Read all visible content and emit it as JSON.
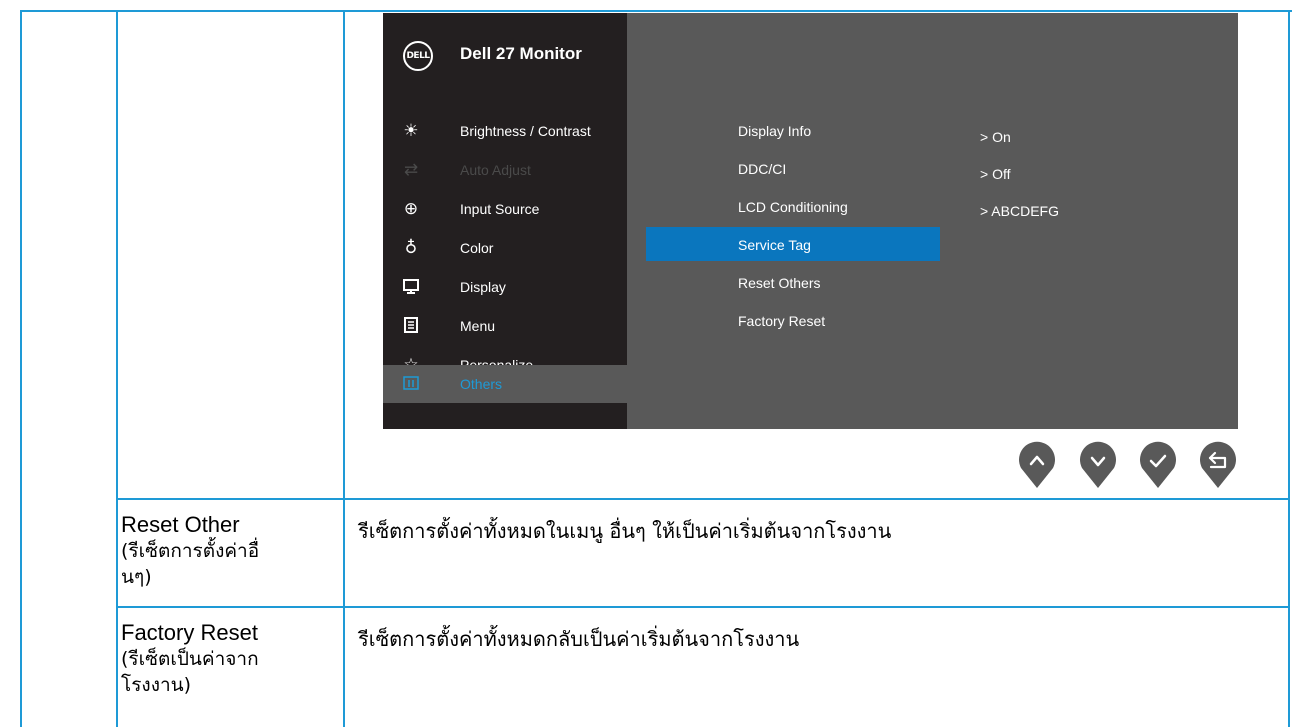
{
  "osd": {
    "title": "Dell 27 Monitor",
    "logo_text": "DELL",
    "menu": [
      {
        "label": "Brightness / Contrast",
        "icon": "brightness-icon",
        "state": "normal"
      },
      {
        "label": "Auto Adjust",
        "icon": "auto-adjust-icon",
        "state": "disabled"
      },
      {
        "label": "Input Source",
        "icon": "input-source-icon",
        "state": "normal"
      },
      {
        "label": "Color",
        "icon": "color-icon",
        "state": "normal"
      },
      {
        "label": "Display",
        "icon": "display-icon",
        "state": "normal"
      },
      {
        "label": "Menu",
        "icon": "menu-icon",
        "state": "normal"
      },
      {
        "label": "Personalize",
        "icon": "star-icon",
        "state": "normal"
      },
      {
        "label": "Others",
        "icon": "others-icon",
        "state": "active"
      }
    ],
    "submenu": [
      {
        "label": "Display Info"
      },
      {
        "label": "DDC/CI",
        "value": ">  On"
      },
      {
        "label": "LCD Conditioning",
        "value": ">  Off"
      },
      {
        "label": "Service Tag",
        "value": ">  ABCDEFG",
        "selected": true
      },
      {
        "label": "Reset Others"
      },
      {
        "label": "Factory Reset"
      }
    ],
    "nav_buttons": [
      "up-icon",
      "down-icon",
      "check-icon",
      "back-icon"
    ],
    "colors": {
      "accent": "#1e9ad6",
      "selected": "#0a76be",
      "panel": "#231f20",
      "background": "#595959"
    }
  },
  "rows": [
    {
      "name_en": "Reset Other",
      "name_th_1": "(รีเซ็ตการตั้งค่าอื่",
      "name_th_2": "นๆ)",
      "description": "รีเซ็ตการตั้งค่าทั้งหมดในเมนู อื่นๆ ให้เป็นค่าเริ่มต้นจากโรงงาน"
    },
    {
      "name_en": "Factory Reset",
      "name_th_1": "(รีเซ็ตเป็นค่าจาก",
      "name_th_2": "โรงงาน)",
      "description": "รีเซ็ตการตั้งค่าทั้งหมดกลับเป็นค่าเริ่มต้นจากโรงงาน"
    }
  ]
}
